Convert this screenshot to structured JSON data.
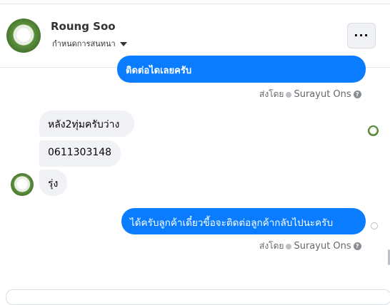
{
  "header": {
    "contact_name": "Roung Soo",
    "subtitle": "กำหนดการสนทนา",
    "more_label": "···"
  },
  "messages": [
    {
      "id": "m1",
      "direction": "outgoing",
      "text": "ติดต่อไดเลยครับ"
    },
    {
      "id": "m2",
      "direction": "incoming",
      "text": "หลัง2ทุ่มครับว่าง"
    },
    {
      "id": "m3",
      "direction": "incoming",
      "text": "0611303148"
    },
    {
      "id": "m4",
      "direction": "incoming",
      "text": "รุ่ง"
    },
    {
      "id": "m5",
      "direction": "outgoing",
      "text": "ได้ครับลูกค้าเดี๋ยวขี้อจะติดต่อลูกค้ากลับไปนะครับ"
    }
  ],
  "sent_by": {
    "prefix": "ส่งโดย",
    "sender": "Surayut Ons",
    "help": "?"
  },
  "colors": {
    "outgoing_bubble": "#0a7cff",
    "incoming_bubble": "#f0f2f5",
    "secondary_text": "#65676b"
  },
  "icons": {
    "more": "more-dots-icon",
    "caret": "caret-down-icon",
    "sent_check": "check-circle-icon",
    "help": "help-icon",
    "seen_avatar": "seen-avatar-icon",
    "delivered": "delivered-icon"
  }
}
